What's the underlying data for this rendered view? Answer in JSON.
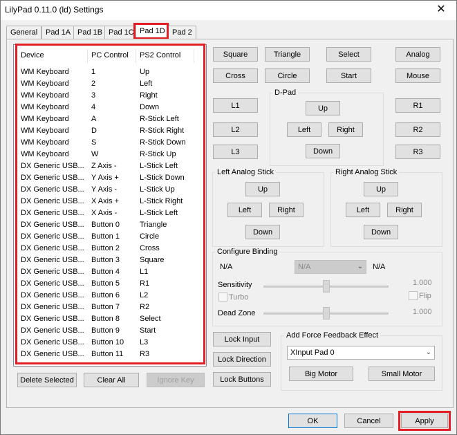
{
  "window": {
    "title": "LilyPad 0.11.0 (ld) Settings",
    "close_glyph": "✕"
  },
  "tabs": [
    {
      "label": "General"
    },
    {
      "label": "Pad 1A"
    },
    {
      "label": "Pad 1B"
    },
    {
      "label": "Pad 1C"
    },
    {
      "label": "Pad 1D"
    },
    {
      "label": "Pad 2"
    }
  ],
  "selected_tab": "Pad 1D",
  "highlight_color": "#e31e24",
  "bindings": {
    "headers": [
      "Device",
      "PC Control",
      "PS2 Control"
    ],
    "rows": [
      [
        "WM Keyboard",
        "1",
        "Up"
      ],
      [
        "WM Keyboard",
        "2",
        "Left"
      ],
      [
        "WM Keyboard",
        "3",
        "Right"
      ],
      [
        "WM Keyboard",
        "4",
        "Down"
      ],
      [
        "WM Keyboard",
        "A",
        "R-Stick Left"
      ],
      [
        "WM Keyboard",
        "D",
        "R-Stick Right"
      ],
      [
        "WM Keyboard",
        "S",
        "R-Stick Down"
      ],
      [
        "WM Keyboard",
        "W",
        "R-Stick Up"
      ],
      [
        "DX Generic   USB...",
        "Z Axis -",
        "L-Stick Left"
      ],
      [
        "DX Generic   USB...",
        "Y Axis +",
        "L-Stick Down"
      ],
      [
        "DX Generic   USB...",
        "Y Axis -",
        "L-Stick Up"
      ],
      [
        "DX Generic   USB...",
        "X Axis +",
        "L-Stick Right"
      ],
      [
        "DX Generic   USB...",
        "X Axis -",
        "L-Stick Left"
      ],
      [
        "DX Generic   USB...",
        "Button 0",
        "Triangle"
      ],
      [
        "DX Generic   USB...",
        "Button 1",
        "Circle"
      ],
      [
        "DX Generic   USB...",
        "Button 2",
        "Cross"
      ],
      [
        "DX Generic   USB...",
        "Button 3",
        "Square"
      ],
      [
        "DX Generic   USB...",
        "Button 4",
        "L1"
      ],
      [
        "DX Generic   USB...",
        "Button 5",
        "R1"
      ],
      [
        "DX Generic   USB...",
        "Button 6",
        "L2"
      ],
      [
        "DX Generic   USB...",
        "Button 7",
        "R2"
      ],
      [
        "DX Generic   USB...",
        "Button 8",
        "Select"
      ],
      [
        "DX Generic   USB...",
        "Button 9",
        "Start"
      ],
      [
        "DX Generic   USB...",
        "Button 10",
        "L3"
      ],
      [
        "DX Generic   USB...",
        "Button 11",
        "R3"
      ]
    ]
  },
  "list_buttons": {
    "delete": "Delete Selected",
    "clear": "Clear All",
    "ignore": "Ignore Key"
  },
  "face_buttons": {
    "square": "Square",
    "triangle": "Triangle",
    "select": "Select",
    "analog": "Analog",
    "cross": "Cross",
    "circle": "Circle",
    "start": "Start",
    "mouse": "Mouse"
  },
  "shoulder": {
    "l1": "L1",
    "l2": "L2",
    "l3": "L3",
    "r1": "R1",
    "r2": "R2",
    "r3": "R3"
  },
  "dpad": {
    "label": "D-Pad",
    "up": "Up",
    "left": "Left",
    "right": "Right",
    "down": "Down"
  },
  "left_stick": {
    "label": "Left Analog Stick",
    "up": "Up",
    "left": "Left",
    "right": "Right",
    "down": "Down"
  },
  "right_stick": {
    "label": "Right Analog Stick",
    "up": "Up",
    "left": "Left",
    "right": "Right",
    "down": "Down"
  },
  "configure": {
    "label": "Configure Binding",
    "left_value": "N/A",
    "combo_value": "N/A",
    "right_value": "N/A",
    "sensitivity_label": "Sensitivity",
    "sensitivity_value": "1.000",
    "sensitivity_level": 0.5,
    "turbo_label": "Turbo",
    "flip_label": "Flip",
    "deadzone_label": "Dead Zone",
    "deadzone_value": "1.000",
    "deadzone_level": 0.5
  },
  "lock_buttons": {
    "input": "Lock Input",
    "direction": "Lock Direction",
    "buttons": "Lock Buttons"
  },
  "force_feedback": {
    "label": "Add Force Feedback Effect",
    "device": "XInput Pad 0",
    "big_motor": "Big Motor",
    "small_motor": "Small Motor"
  },
  "footer": {
    "ok": "OK",
    "cancel": "Cancel",
    "apply": "Apply"
  },
  "icons": {
    "dropdown": "chevron-down-icon",
    "close": "close-icon"
  }
}
